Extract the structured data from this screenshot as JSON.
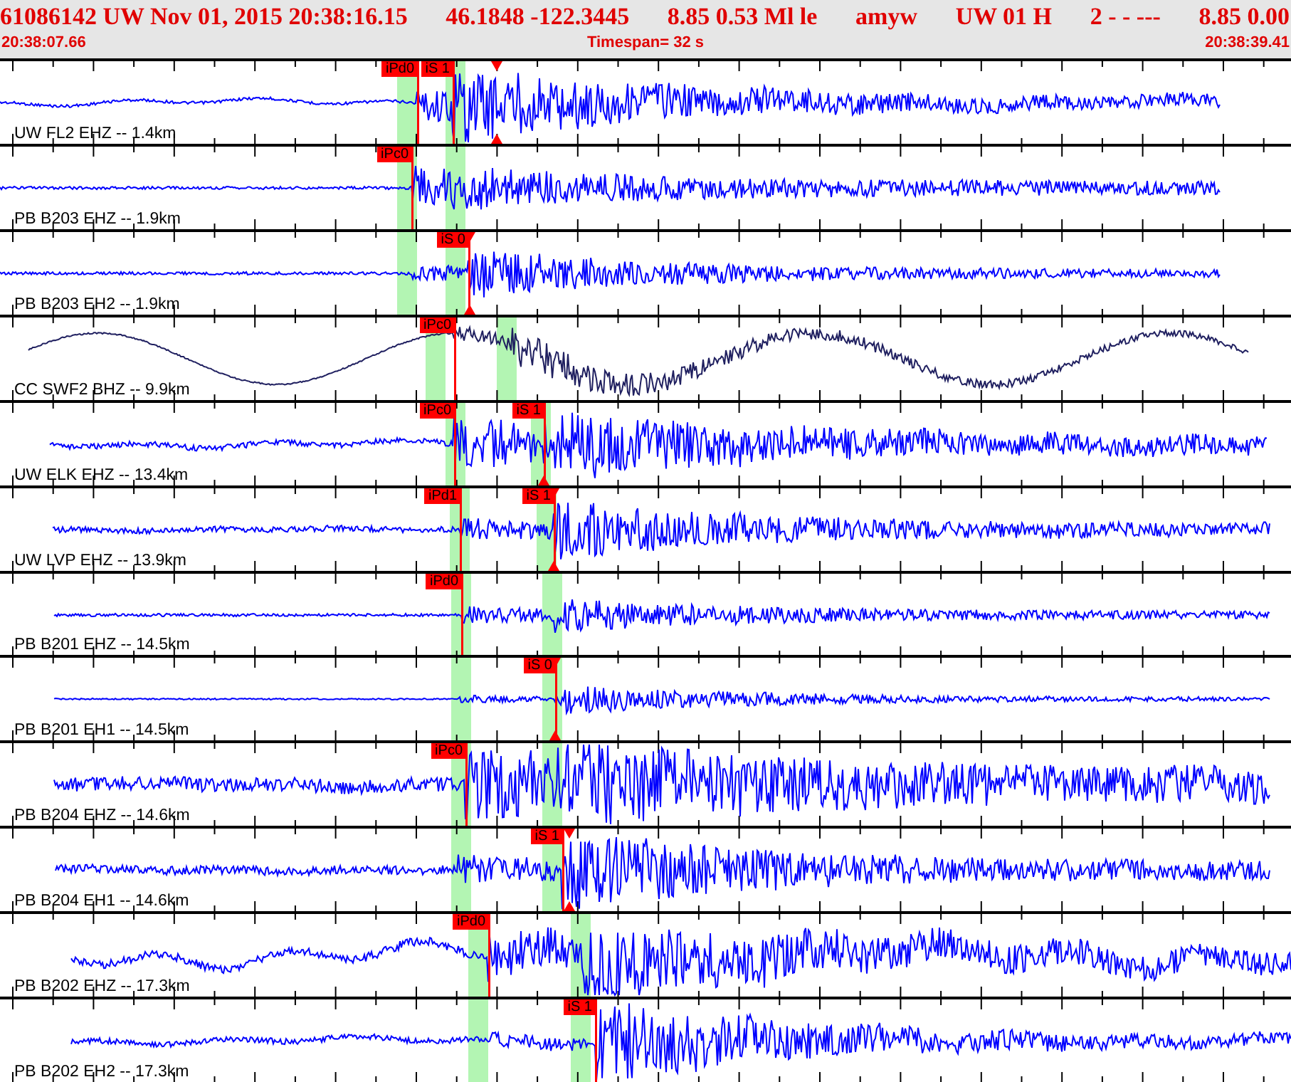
{
  "header": {
    "fields": [
      "61086142 UW Nov 01, 2015 20:38:16.15",
      "46.1848 -122.3445",
      "8.85 0.53 Ml le",
      "amyw",
      "UW 01 H",
      "2 - - ---",
      "8.85 0.00"
    ],
    "start_time": "20:38:07.66",
    "timespan": "Timespan=  32 s",
    "end_time": "20:38:39.41"
  },
  "traces": [
    {
      "station": "UW FL2 EHZ -- 1.4km",
      "picks": [
        {
          "label": "iPd0"
        },
        {
          "label": "iS 1"
        }
      ]
    },
    {
      "station": "PB B203 EHZ -- 1.9km",
      "picks": [
        {
          "label": "iPc0"
        }
      ]
    },
    {
      "station": "PB B203 EH2 -- 1.9km",
      "picks": [
        {
          "label": "iS 0"
        }
      ]
    },
    {
      "station": "CC SWF2 BHZ -- 9.9km",
      "picks": [
        {
          "label": "iPc0"
        }
      ]
    },
    {
      "station": "UW ELK EHZ -- 13.4km",
      "picks": [
        {
          "label": "iPc0"
        },
        {
          "label": "iS 1"
        }
      ]
    },
    {
      "station": "UW LVP EHZ -- 13.9km",
      "picks": [
        {
          "label": "iPd1"
        },
        {
          "label": "iS 1"
        }
      ]
    },
    {
      "station": "PB B201 EHZ -- 14.5km",
      "picks": [
        {
          "label": "iPd0"
        }
      ]
    },
    {
      "station": "PB B201 EH1 -- 14.5km",
      "picks": [
        {
          "label": "iS 0"
        }
      ]
    },
    {
      "station": "PB B204 EHZ -- 14.6km",
      "picks": [
        {
          "label": "iPc0"
        }
      ]
    },
    {
      "station": "PB B204 EH1 -- 14.6km",
      "picks": [
        {
          "label": "iS 1"
        }
      ]
    },
    {
      "station": "PB B202 EHZ -- 17.3km",
      "picks": [
        {
          "label": "iPd0"
        }
      ]
    },
    {
      "station": "PB B202 EH2 -- 17.3km",
      "picks": [
        {
          "label": "iS 1"
        }
      ]
    }
  ]
}
